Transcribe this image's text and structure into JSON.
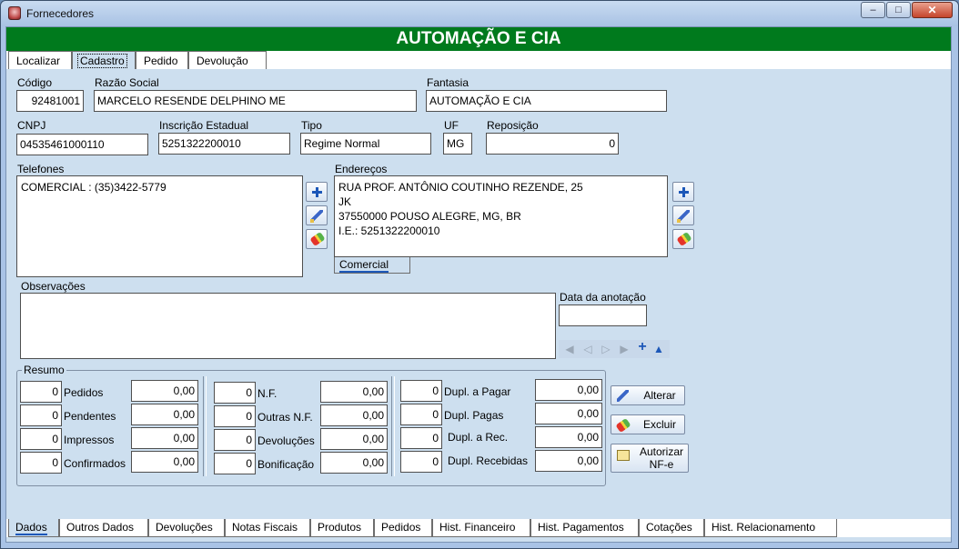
{
  "window": {
    "title": "Fornecedores",
    "minimize": "–",
    "maximize": "□",
    "close": "✕"
  },
  "banner": {
    "text": "AUTOMAÇÃO E CIA"
  },
  "top_tabs": [
    "Localizar",
    "Cadastro",
    "Pedido",
    "Devolução"
  ],
  "form": {
    "codigo": {
      "label": "Código",
      "value": "92481001"
    },
    "razao_social": {
      "label": "Razão Social",
      "value": "MARCELO RESENDE DELPHINO ME"
    },
    "fantasia": {
      "label": "Fantasia",
      "value": "AUTOMAÇÃO E CIA"
    },
    "cnpj": {
      "label": "CNPJ",
      "value": "04535461000110"
    },
    "inscricao": {
      "label": "Inscrição Estadual",
      "value": "5251322200010"
    },
    "tipo": {
      "label": "Tipo",
      "value": "Regime Normal"
    },
    "uf": {
      "label": "UF",
      "value": "MG"
    },
    "reposicao": {
      "label": "Reposição",
      "value": "0"
    }
  },
  "telefones": {
    "label": "Telefones",
    "lines": [
      "COMERCIAL : (35)3422-5779"
    ]
  },
  "enderecos": {
    "label": "Endereços",
    "lines": [
      "RUA PROF. ANTÔNIO COUTINHO REZENDE, 25",
      "JK",
      "37550000 POUSO ALEGRE, MG, BR",
      "I.E.: 5251322200010"
    ],
    "tab": "Comercial"
  },
  "observacoes": {
    "label": "Observações",
    "value": ""
  },
  "data_anotacao": {
    "label": "Data da anotação",
    "value": ""
  },
  "resumo": {
    "title": "Resumo",
    "col1": [
      {
        "label": "Pedidos",
        "count": "0",
        "amount": "0,00"
      },
      {
        "label": "Pendentes",
        "count": "0",
        "amount": "0,00"
      },
      {
        "label": "Impressos",
        "count": "0",
        "amount": "0,00"
      },
      {
        "label": "Confirmados",
        "count": "0",
        "amount": "0,00"
      }
    ],
    "col2": [
      {
        "label": "N.F.",
        "count": "0",
        "amount": "0,00"
      },
      {
        "label": "Outras N.F.",
        "count": "0",
        "amount": "0,00"
      },
      {
        "label": "Devoluções",
        "count": "0",
        "amount": "0,00"
      },
      {
        "label": "Bonificação",
        "count": "0",
        "amount": "0,00"
      }
    ],
    "col3": [
      {
        "label": "Dupl. a Pagar",
        "count": "0",
        "amount": "0,00"
      },
      {
        "label": "Dupl. Pagas",
        "count": "0",
        "amount": "0,00"
      },
      {
        "label": "Dupl. a Rec.",
        "count": "0",
        "amount": "0,00"
      },
      {
        "label": "Dupl. Recebidas",
        "count": "0",
        "amount": "0,00"
      }
    ]
  },
  "actions": {
    "alterar": "Alterar",
    "excluir": "Excluir",
    "autorizar_l1": "Autorizar",
    "autorizar_l2": "NF-e"
  },
  "bottom_tabs": [
    "Dados",
    "Outros Dados",
    "Devoluções",
    "Notas Fiscais",
    "Produtos",
    "Pedidos",
    "Hist. Financeiro",
    "Hist. Pagamentos",
    "Cotações",
    "Hist. Relacionamento"
  ],
  "colors": {
    "banner": "#007a1d",
    "accent": "#1c57b8",
    "background": "#cddfef"
  }
}
